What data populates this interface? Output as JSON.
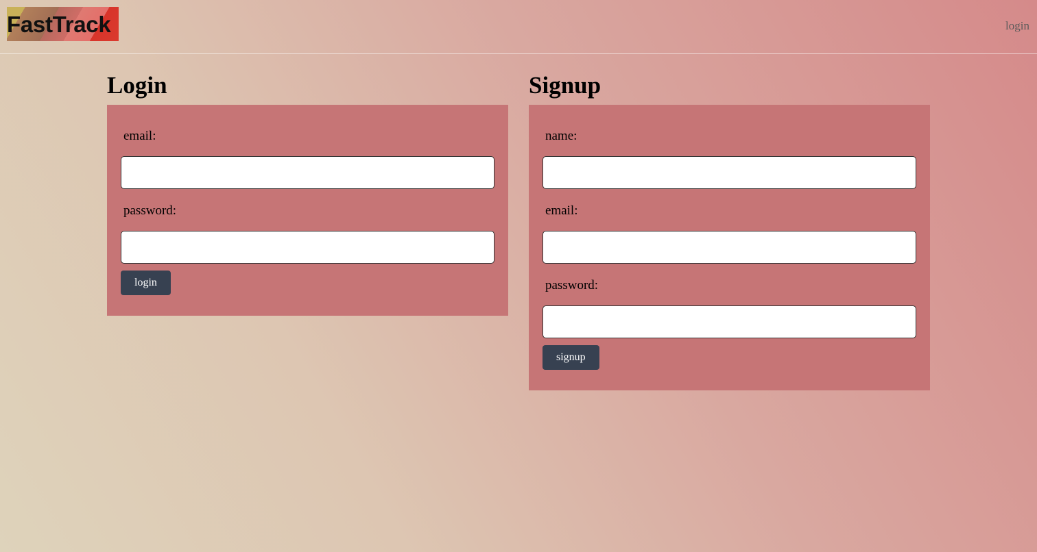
{
  "header": {
    "logo_text": "FastTrack",
    "nav_login_label": "login"
  },
  "login": {
    "title": "Login",
    "email_label": "email:",
    "password_label": "password:",
    "email_value": "",
    "password_value": "",
    "submit_label": "login"
  },
  "signup": {
    "title": "Signup",
    "name_label": "name:",
    "email_label": "email:",
    "password_label": "password:",
    "name_value": "",
    "email_value": "",
    "password_value": "",
    "submit_label": "signup"
  },
  "colors": {
    "card_background": "#c67576",
    "button_background": "#374151",
    "logo_accent_red": "#d8342a",
    "logo_accent_gold": "#c9b158"
  }
}
